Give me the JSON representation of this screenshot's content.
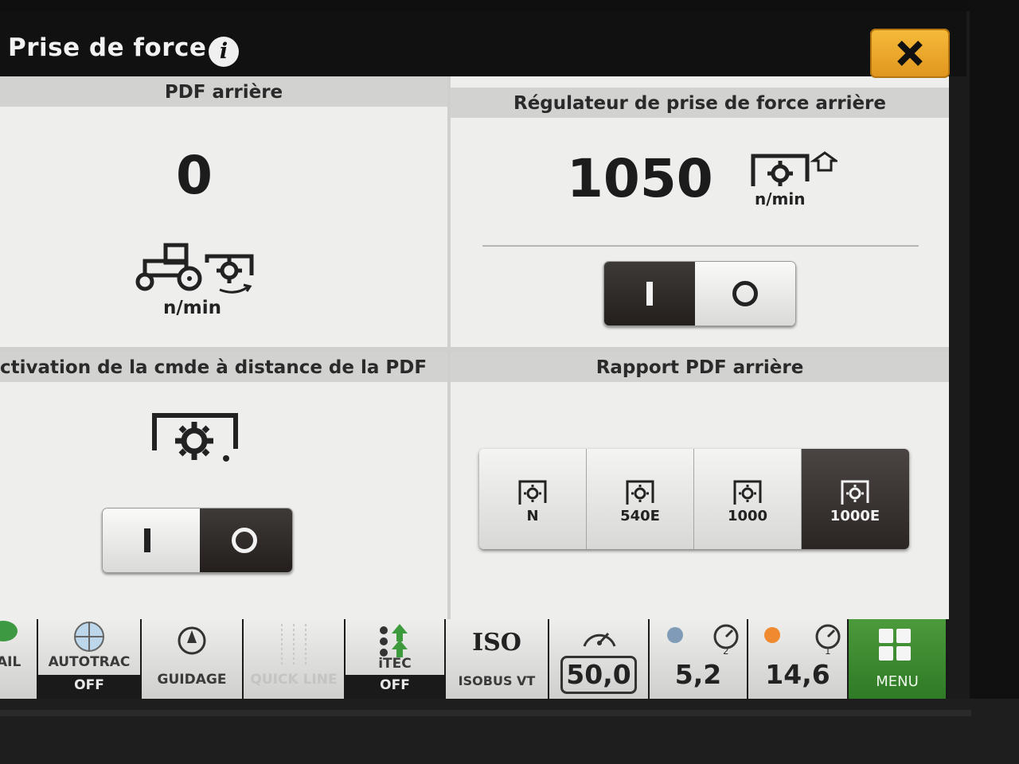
{
  "window": {
    "title": "Prise de force"
  },
  "panels": {
    "rear_pto": {
      "header": "PDF arrière",
      "speed_value": "0",
      "unit": "n/min"
    },
    "regulator": {
      "header": "Régulateur de prise de force arrière",
      "speed_value": "1050",
      "unit": "n/min",
      "toggle_on_label": "I",
      "toggle_off_label": "O",
      "toggle_state": "on"
    },
    "remote": {
      "header": "ctivation de la cmde à distance de la PDF",
      "toggle_on_label": "I",
      "toggle_off_label": "O",
      "toggle_state": "off"
    },
    "ratio": {
      "header": "Rapport PDF arrière",
      "options": [
        "N",
        "540E",
        "1000",
        "1000E"
      ],
      "selected": "1000E"
    }
  },
  "bottom_bar": {
    "items": [
      {
        "label": "AIL",
        "value": ""
      },
      {
        "label": "AUTOTRAC",
        "value": "OFF"
      },
      {
        "label": "GUIDAGE",
        "value": ""
      },
      {
        "label": "QUICK LINE",
        "value": ""
      },
      {
        "label": "iTEC",
        "value": "OFF"
      },
      {
        "label": "ISOBUS VT",
        "value": ""
      }
    ],
    "iso_logo": "ISO",
    "speed": "50,0",
    "engine_1": "5,2",
    "engine_2": "14,6",
    "menu": "MENU"
  },
  "colors": {
    "accent_close": "#f0a52a",
    "selected_dark": "#2b2624",
    "menu_green": "#3d8a30"
  }
}
